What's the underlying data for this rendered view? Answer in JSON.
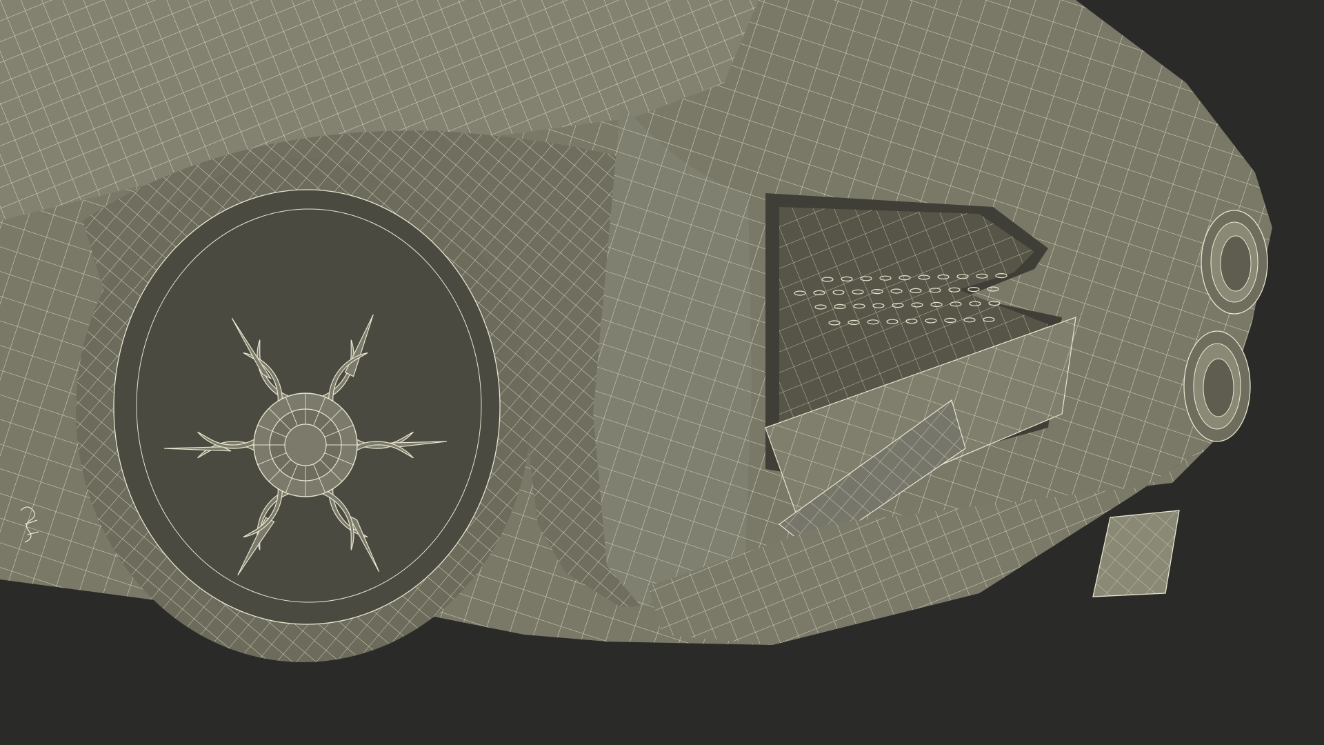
{
  "scene": {
    "subject": "wireframe-car-rear-quarter",
    "colors": {
      "background": "#2a2a28",
      "surface": "#7a7968",
      "surface_light": "#8a8975",
      "surface_dark": "#5e5d50",
      "shadow": "#3f3f37",
      "wire": "#e8e6cf"
    }
  }
}
